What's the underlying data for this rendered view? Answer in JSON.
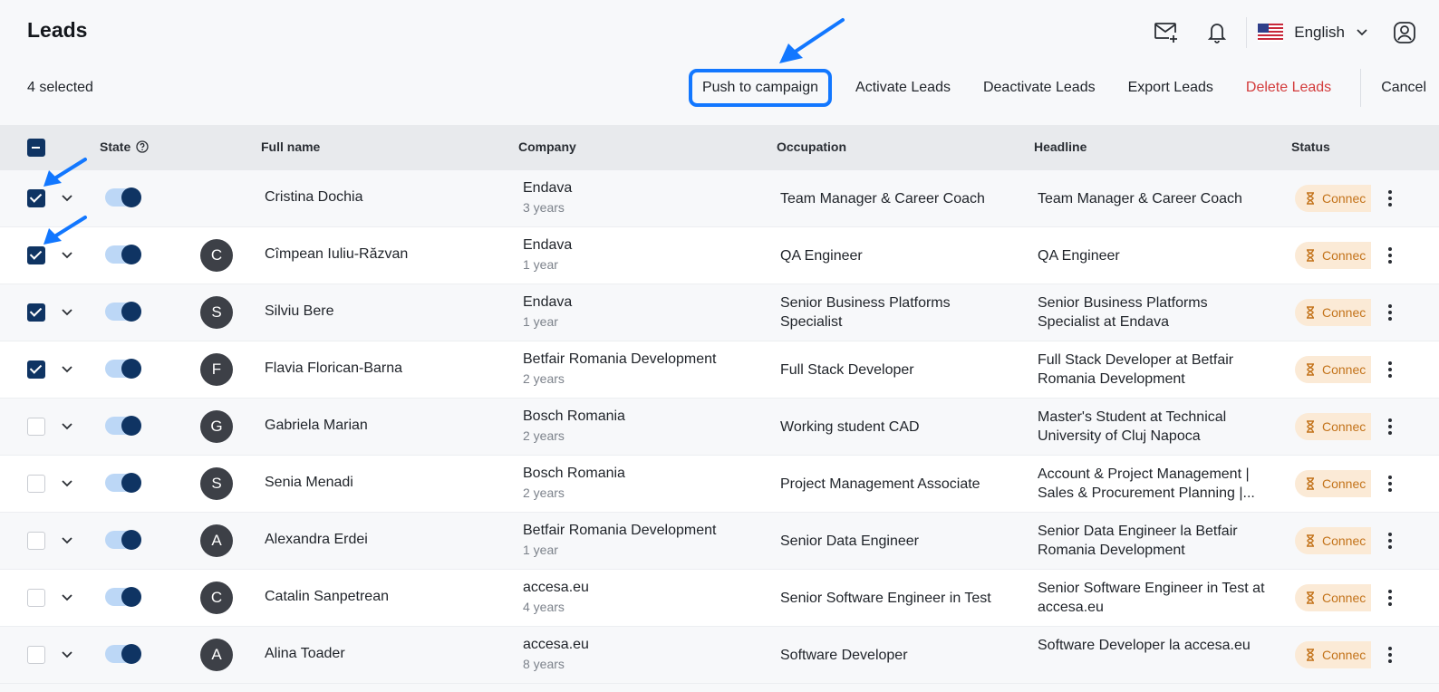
{
  "header": {
    "title": "Leads",
    "language": "English"
  },
  "actionbar": {
    "selected_label": "4 selected",
    "push_to_campaign": "Push to campaign",
    "activate": "Activate Leads",
    "deactivate": "Deactivate Leads",
    "export": "Export Leads",
    "delete": "Delete Leads",
    "cancel": "Cancel"
  },
  "table": {
    "columns": {
      "state": "State",
      "full_name": "Full name",
      "company": "Company",
      "occupation": "Occupation",
      "headline": "Headline",
      "status": "Status"
    },
    "rows": [
      {
        "checked": true,
        "initial": "",
        "name": "Cristina Dochia",
        "company": "Endava",
        "years": "3 years",
        "occupation": "Team Manager & Career Coach",
        "headline": "Team Manager & Career Coach",
        "status": "Connec"
      },
      {
        "checked": true,
        "initial": "C",
        "name": "Cîmpean Iuliu-Răzvan",
        "company": "Endava",
        "years": "1 year",
        "occupation": "QA Engineer",
        "headline": "QA Engineer",
        "status": "Connec"
      },
      {
        "checked": true,
        "initial": "S",
        "name": "Silviu Bere",
        "company": "Endava",
        "years": "1 year",
        "occupation": "Senior Business Platforms Specialist",
        "headline": "Senior Business Platforms Specialist at Endava",
        "status": "Connec"
      },
      {
        "checked": true,
        "initial": "F",
        "name": "Flavia Florican-Barna",
        "company": "Betfair Romania Development",
        "years": "2 years",
        "occupation": "Full Stack Developer",
        "headline": "Full Stack Developer at Betfair Romania Development",
        "status": "Connec"
      },
      {
        "checked": false,
        "initial": "G",
        "name": "Gabriela Marian",
        "company": "Bosch Romania",
        "years": "2 years",
        "occupation": "Working student CAD",
        "headline": "Master's Student at Technical University of Cluj Napoca",
        "status": "Connec"
      },
      {
        "checked": false,
        "initial": "S",
        "name": "Senia Menadi",
        "company": "Bosch Romania",
        "years": "2 years",
        "occupation": "Project Management Associate",
        "headline": "Account & Project Management | Sales & Procurement Planning |...",
        "status": "Connec"
      },
      {
        "checked": false,
        "initial": "A",
        "name": "Alexandra Erdei",
        "company": "Betfair Romania Development",
        "years": "1 year",
        "occupation": "Senior Data Engineer",
        "headline": "Senior Data Engineer la Betfair Romania Development",
        "status": "Connec"
      },
      {
        "checked": false,
        "initial": "C",
        "name": "Catalin Sanpetrean",
        "company": "accesa.eu",
        "years": "4 years",
        "occupation": "Senior Software Engineer in Test",
        "headline": "Senior Software Engineer in Test at accesa.eu",
        "status": "Connec"
      },
      {
        "checked": false,
        "initial": "A",
        "name": "Alina Toader",
        "company": "accesa.eu",
        "years": "8 years",
        "occupation": "Software Developer",
        "headline": "Software Developer la accesa.eu",
        "status": "Connec"
      }
    ]
  },
  "colors": {
    "accent": "#0f3463",
    "toggle_track": "#bcd7f6",
    "status_bg": "#fbead6",
    "status_text": "#c3731a",
    "delete": "#d33b3b",
    "annotation": "#1277ff"
  }
}
